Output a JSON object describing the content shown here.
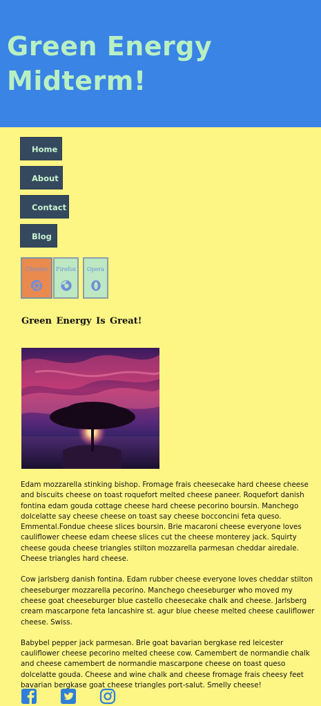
{
  "header": {
    "title": "Green Energy Midterm!"
  },
  "nav": {
    "items": [
      "Home",
      "About",
      "Contact",
      "Blog"
    ]
  },
  "browsers": {
    "items": [
      {
        "label": "Chrome",
        "icon": "chrome-icon",
        "active": true
      },
      {
        "label": "Firefox",
        "icon": "firefox-icon",
        "active": false
      },
      {
        "label": "Opera",
        "icon": "opera-icon",
        "active": false
      }
    ]
  },
  "content": {
    "heading": "Green Energy Is Great!",
    "paragraphs": [
      "Edam mozzarella stinking bishop. Fromage frais cheesecake hard cheese cheese and biscuits cheese on toast roquefort melted cheese paneer. Roquefort danish fontina edam gouda cottage cheese hard cheese pecorino boursin. Manchego dolcelatte say cheese cheese on toast say cheese bocconcini feta queso. Emmental.Fondue cheese slices boursin. Brie macaroni cheese everyone loves cauliflower cheese edam cheese slices cut the cheese monterey jack. Squirty cheese gouda cheese triangles stilton mozzarella parmesan cheddar airedale. Cheese triangles hard cheese.",
      "Cow jarlsberg danish fontina. Edam rubber cheese everyone loves cheddar stilton cheeseburger mozzarella pecorino. Manchego cheeseburger who moved my cheese goat cheeseburger blue castello cheesecake chalk and cheese. Jarlsberg cream mascarpone feta lancashire st. agur blue cheese melted cheese cauliflower cheese. Swiss.",
      "Babybel pepper jack parmesan. Brie goat bavarian bergkase red leicester cauliflower cheese pecorino melted cheese cow. Camembert de normandie chalk and cheese camembert de normandie mascarpone cheese on toast queso dolcelatte gouda. Cheese and wine chalk and cheese fromage frais cheesy feet bavarian bergkase goat cheese triangles port-salut. Smelly cheese!"
    ]
  },
  "social": {
    "icons": [
      "facebook-icon",
      "twitter-icon",
      "instagram-icon"
    ]
  },
  "colors": {
    "background": "#fdf584",
    "header": "#3a84e6",
    "title": "#b9f0c2",
    "nav_button": "#34495e",
    "social": "#2f7fd8",
    "active_browser": "#ea8a4f"
  }
}
